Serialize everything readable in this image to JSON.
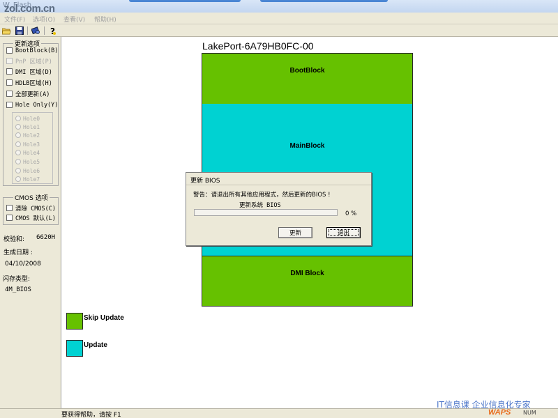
{
  "window": {
    "title": "W_Flash",
    "watermark_logo": "zol.com.cn"
  },
  "menu": [
    "文件(F)",
    "选项(O)",
    "查看(V)",
    "帮助(H)"
  ],
  "toolbar": {
    "icons": [
      "open-folder-icon",
      "save-icon",
      "flash-chip-icon",
      "help-icon"
    ]
  },
  "update_options": {
    "legend": "更新选项",
    "items": [
      {
        "label": "BootBlock(B)",
        "enabled": true
      },
      {
        "label": "PnP 区域(P)",
        "enabled": false
      },
      {
        "label": "DMI 区域(D)",
        "enabled": true
      },
      {
        "label": "HDLB区域(H)",
        "enabled": true
      },
      {
        "label": "全部更新(A)",
        "enabled": true
      },
      {
        "label": "Hole Only(Y)",
        "enabled": true
      }
    ],
    "holes": [
      "Hole0",
      "Hole1",
      "Hole2",
      "Hole3",
      "Hole4",
      "Hole5",
      "Hole6",
      "Hole7"
    ]
  },
  "cmos_options": {
    "legend": "CMOS 选项",
    "items": [
      {
        "label": "清除 CMOS(C)"
      },
      {
        "label": "CMOS 默认(L)"
      }
    ]
  },
  "info": {
    "checksum_label": "校验和:",
    "checksum_value": "6620H",
    "build_date_label": "生成日期 :",
    "build_date_value": "04/10/2008",
    "flash_type_label": "闪存类型:",
    "flash_type_value": "4M_BIOS"
  },
  "main": {
    "bios_title": "LakePort-6A79HB0FC-00",
    "blocks": [
      {
        "label": "BootBlock",
        "color": "#66c100"
      },
      {
        "label": "MainBlock",
        "color": "#00d2d2"
      },
      {
        "label": "DMI Block",
        "color": "#66c100"
      }
    ],
    "legend": [
      {
        "label": "Skip Update",
        "color": "#66c100"
      },
      {
        "label": "Update",
        "color": "#00d2d2"
      }
    ]
  },
  "dialog": {
    "title": "更新 BIOS",
    "warning": "警告：请退出所有其他应用程式，然后更新的BIOS !",
    "status": "更新系统 BIOS",
    "progress": 0,
    "progress_text": "0 %",
    "update_button": "更新",
    "exit_button": "退出"
  },
  "statusbar": {
    "help_text": "要获得帮助，请按 F1",
    "num_indicator": "NUM"
  },
  "watermark": {
    "text": "IT信息课  企业信息化专家",
    "logo": "WAPS"
  }
}
